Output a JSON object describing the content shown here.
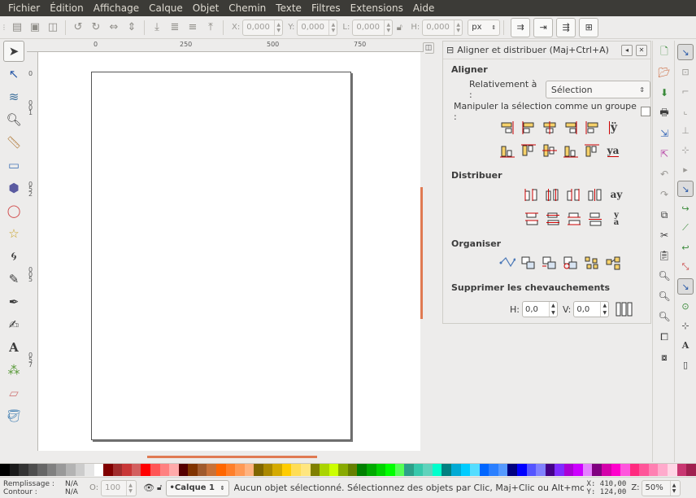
{
  "menubar": {
    "items": [
      "Fichier",
      "Édition",
      "Affichage",
      "Calque",
      "Objet",
      "Chemin",
      "Texte",
      "Filtres",
      "Extensions",
      "Aide"
    ]
  },
  "toolbar": {
    "x_label": "X:",
    "x_value": "0,000",
    "y_label": "Y:",
    "y_value": "0,000",
    "w_label": "L:",
    "w_value": "0,000",
    "h_label": "H:",
    "h_value": "0,000",
    "unit": "px"
  },
  "rulers": {
    "h_ticks": [
      "0",
      "250",
      "500",
      "750"
    ],
    "v_ticks": [
      "0",
      "0\n0\n1",
      "0\n5\n2",
      "0\n0\n5",
      "0\n5\n7"
    ]
  },
  "dock": {
    "title": "Aligner et distribuer (Maj+Ctrl+A)",
    "align_section": "Aligner",
    "relative_label": "Relativement à :",
    "relative_value": "Sélection",
    "group_label": "Manipuler la sélection comme un groupe :",
    "distribute_section": "Distribuer",
    "arrange_section": "Organiser",
    "overlap_section": "Supprimer les chevauchements",
    "h_label": "H:",
    "h_value": "0,0",
    "v_label": "V:",
    "v_value": "0,0"
  },
  "status": {
    "fill_label": "Remplissage :",
    "fill_value": "N/A",
    "stroke_label": "Contour :",
    "stroke_value": "N/A",
    "opacity_label": "O:",
    "opacity_value": "100",
    "layer": "•Calque 1",
    "message": "Aucun objet sélectionné. Sélectionnez des objets par Clic, Maj+Clic ou Alt+molette, o...",
    "cursor_x": "X: 410,00",
    "cursor_y": "Y: 124,00",
    "zoom_label": "Z:",
    "zoom_value": "50%"
  },
  "palette": [
    "#000000",
    "#1a1a1a",
    "#333333",
    "#4d4d4d",
    "#666666",
    "#808080",
    "#999999",
    "#b3b3b3",
    "#cccccc",
    "#e6e6e6",
    "#ffffff",
    "#800000",
    "#a02c2c",
    "#c83737",
    "#d35f5f",
    "#ff0000",
    "#ff5555",
    "#ff8080",
    "#ffaaaa",
    "#550000",
    "#803300",
    "#a05a2c",
    "#c87137",
    "#ff6600",
    "#ff7f2a",
    "#ff9955",
    "#ffb380",
    "#806600",
    "#aa8800",
    "#d4aa00",
    "#ffcc00",
    "#ffdd55",
    "#ffe680",
    "#808000",
    "#aad400",
    "#ccff00",
    "#88aa00",
    "#668000",
    "#008000",
    "#00aa00",
    "#00d400",
    "#00ff00",
    "#55ff55",
    "#2ca089",
    "#37c8ab",
    "#5fd3bc",
    "#00ffcc",
    "#008080",
    "#00aad4",
    "#00ccff",
    "#55ddff",
    "#0066ff",
    "#2a7fff",
    "#5599ff",
    "#000080",
    "#0000ff",
    "#5555ff",
    "#8080ff",
    "#440088",
    "#7f2aff",
    "#aa00d4",
    "#cc00ff",
    "#e580ff",
    "#800080",
    "#d400aa",
    "#ff00cc",
    "#ff55dd",
    "#ff2a7f",
    "#ff5599",
    "#ff80b2",
    "#ffaacc",
    "#ffd5e5",
    "#c83771",
    "#a0204f"
  ]
}
